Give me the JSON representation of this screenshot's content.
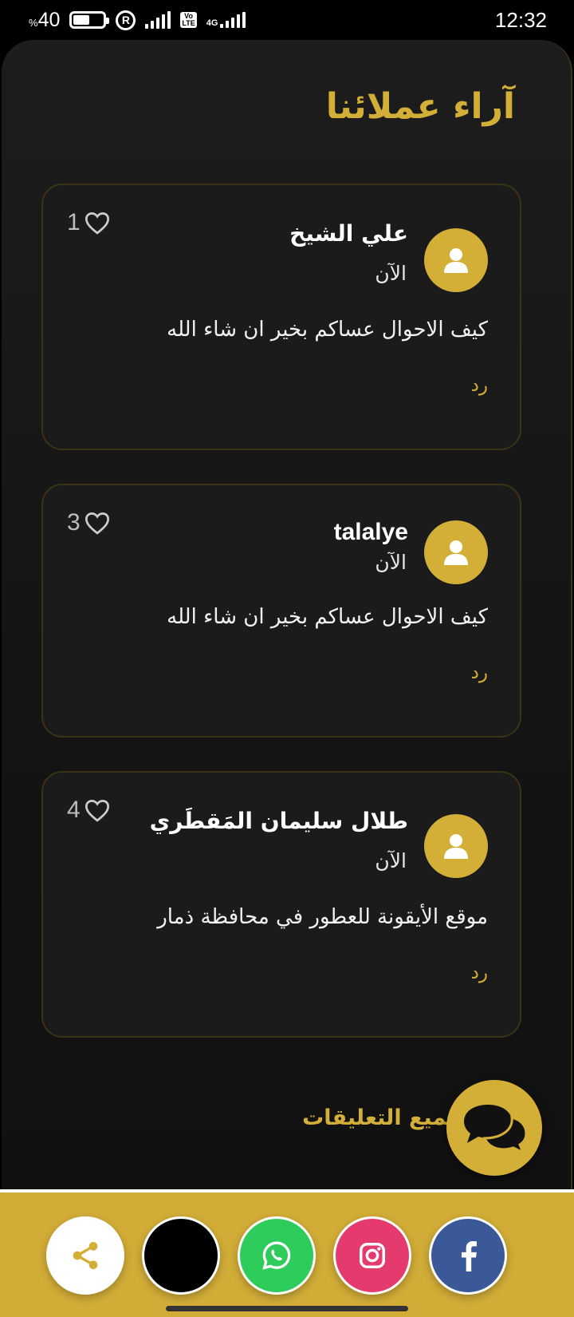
{
  "status_bar": {
    "battery_percent": "40",
    "battery_symbol": "%",
    "time": "12:32",
    "network": "4G"
  },
  "page": {
    "title": "آراء عملائنا",
    "all_comments_label": "جميع التعليقات"
  },
  "comments": [
    {
      "author": "علي الشيخ",
      "time": "الآن",
      "text": "كيف الاحوال عساكم بخير ان شاء الله",
      "likes": "1",
      "reply_label": "رد"
    },
    {
      "author": "talalye",
      "time": "الآن",
      "text": "كيف الاحوال عساكم بخير ان شاء الله",
      "likes": "3",
      "reply_label": "رد"
    },
    {
      "author": "طلال سليمان المَقطَري",
      "time": "الآن",
      "text": "موقع الأيقونة للعطور في محافظة ذمار",
      "likes": "4",
      "reply_label": "رد"
    }
  ],
  "social_buttons": [
    {
      "name": "share",
      "icon": "share-icon",
      "color": "#ffffff"
    },
    {
      "name": "tiktok",
      "icon": "tiktok-icon",
      "color": "#000000"
    },
    {
      "name": "whatsapp",
      "icon": "whatsapp-icon",
      "color": "#2ecc5a"
    },
    {
      "name": "instagram",
      "icon": "instagram-icon",
      "color": "#e53a6e"
    },
    {
      "name": "facebook",
      "icon": "facebook-icon",
      "color": "#3b5998"
    }
  ],
  "colors": {
    "accent": "#d4af37",
    "background": "#141414",
    "card_border": "#3a3318"
  }
}
